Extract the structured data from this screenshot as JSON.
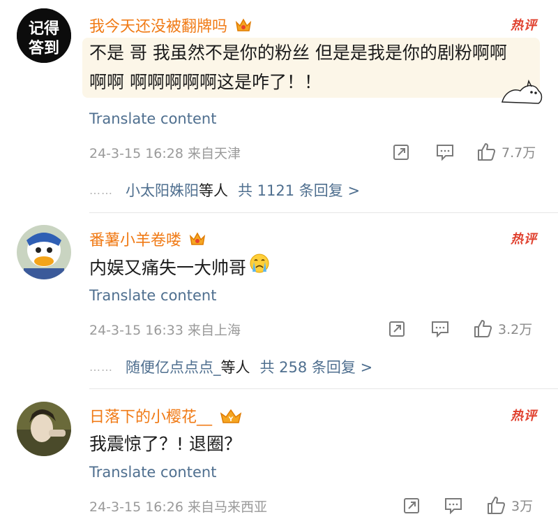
{
  "comments": [
    {
      "author": "我今天还没被翻牌吗",
      "badge": "热评",
      "lines": [
        "不是 哥 我虽然不是你的粉丝 但是是我是你的剧粉啊啊",
        "啊啊 啊啊啊啊啊这是咋了！！"
      ],
      "translate": "Translate content",
      "meta": "24-3-15 16:28 来自天津",
      "likes": "7.7万",
      "reply_user": "小太阳姝阳",
      "reply_suffix": "等人",
      "reply_count": "共 1121 条回复 >"
    },
    {
      "author": "番薯小羊卷喽",
      "badge": "热评",
      "lines": [
        "内娱又痛失一大帅哥"
      ],
      "translate": "Translate content",
      "meta": "24-3-15 16:33 来自上海",
      "likes": "3.2万",
      "reply_user": "随便亿点点点_",
      "reply_suffix": "等人",
      "reply_count": "共 258 条回复 >"
    },
    {
      "author": "日落下的小樱花__",
      "badge": "热评",
      "lines": [
        "我震惊了？!  退圈？"
      ],
      "translate": "Translate content",
      "meta": "24-3-15 16:26 来自马来西亚",
      "likes": "3万"
    }
  ],
  "avatar_1_text": [
    "记得",
    "答到"
  ],
  "colors": {
    "author": "#f07a15",
    "link": "#4f6f8f",
    "hot": "#e0412f",
    "meta": "#9a9a9a"
  }
}
